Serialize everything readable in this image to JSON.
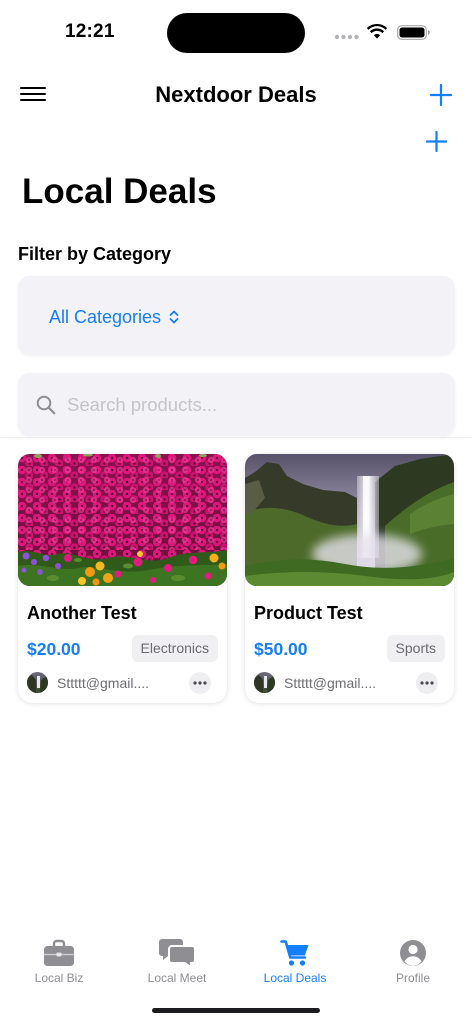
{
  "status_bar": {
    "time": "12:21",
    "icons": [
      "signal-dots-icon",
      "wifi-icon",
      "battery-icon"
    ]
  },
  "nav": {
    "title": "Nextdoor Deals",
    "menu_icon": "hamburger-menu-icon",
    "add_icon": "plus-icon"
  },
  "page": {
    "title": "Local Deals"
  },
  "filter": {
    "label": "Filter by Category",
    "selected": "All Categories",
    "chevron_icon": "chevron-up-down-icon"
  },
  "search": {
    "placeholder": "Search products...",
    "icon": "magnifying-glass-icon"
  },
  "products": [
    {
      "title": "Another Test",
      "price": "$20.00",
      "category": "Electronics",
      "seller": "Sttttt@gmail...."
    },
    {
      "title": "Product Test",
      "price": "$50.00",
      "category": "Sports",
      "seller": "Sttttt@gmail...."
    }
  ],
  "tabs": [
    {
      "label": "Local Biz",
      "icon": "briefcase-icon",
      "active": false
    },
    {
      "label": "Local Meet",
      "icon": "chat-bubbles-icon",
      "active": false
    },
    {
      "label": "Local Deals",
      "icon": "cart-icon",
      "active": true
    },
    {
      "label": "Profile",
      "icon": "person-circle-icon",
      "active": false
    }
  ],
  "colors": {
    "accent": "#147efb",
    "inactive": "#8e8e93",
    "text": "#000000",
    "secondary": "#6e6e73",
    "field_bg": "#f2f2f7",
    "badge_bg": "#f0f0f3"
  }
}
